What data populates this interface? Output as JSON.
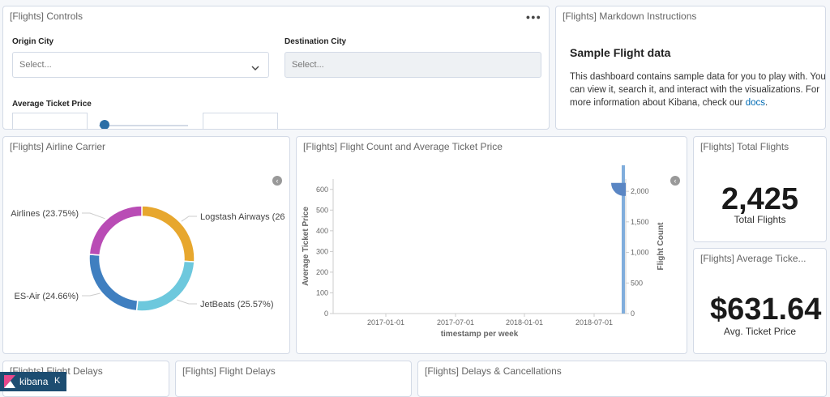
{
  "controls": {
    "title": "[Flights] Controls",
    "origin_label": "Origin City",
    "origin_placeholder": "Select...",
    "dest_label": "Destination City",
    "dest_placeholder": "Select...",
    "price_label": "Average Ticket Price",
    "slider_value": 0.03
  },
  "markdown": {
    "title": "[Flights] Markdown Instructions",
    "heading": "Sample Flight data",
    "body": "This dashboard contains sample data for you to play with. You can view it, search it, and interact with the visualizations. For more information about Kibana, check our",
    "link": "docs",
    "end": "."
  },
  "airline": {
    "title": "[Flights] Airline Carrier",
    "slices": [
      {
        "label": "Logstash Airways (26",
        "pct": 26.02,
        "color": "#e7a72e"
      },
      {
        "label": "JetBeats (25.57%)",
        "pct": 25.57,
        "color": "#6dc8dd"
      },
      {
        "label": "ES-Air (24.66%)",
        "pct": 24.66,
        "color": "#3f7fc0"
      },
      {
        "label": "Airlines (23.75%)",
        "pct": 23.75,
        "color": "#b94cb5"
      }
    ]
  },
  "flightcount": {
    "title": "[Flights] Flight Count and Average Ticket Price"
  },
  "chart_data": {
    "type": "bar",
    "xlabel": "timestamp per week",
    "ylabel": "Average Ticket Price",
    "y2label": "Flight Count",
    "x_ticks": [
      "2017-01-01",
      "2017-07-01",
      "2018-01-01",
      "2018-07-01"
    ],
    "y_ticks": [
      0,
      100,
      200,
      300,
      400,
      500,
      600
    ],
    "y2_ticks": [
      "0",
      "500",
      "1,000",
      "1,500",
      "2,000"
    ],
    "ylim": [
      0,
      650
    ],
    "y2lim": [
      0,
      2200
    ],
    "series": [
      {
        "name": "Flight Count",
        "x": [
          "2018-08-12"
        ],
        "values": [
          2425
        ],
        "color": "#6a9fd6"
      },
      {
        "name": "Average Ticket Price",
        "x": [
          "2018-08-12"
        ],
        "values": [
          631.64
        ],
        "color": "#5a86c4"
      }
    ]
  },
  "total_flights": {
    "title": "[Flights] Total Flights",
    "value": "2,425",
    "label": "Total Flights"
  },
  "avg_price": {
    "title": "[Flights] Average Ticke...",
    "value": "$631.64",
    "label": "Avg. Ticket Price"
  },
  "bottom": {
    "p1_title": "[Flights] Flight Delays",
    "p2_title": "[Flights] Flight Delays",
    "p3_title": "[Flights] Delays & Cancellations"
  },
  "kibana_label": "kibana"
}
